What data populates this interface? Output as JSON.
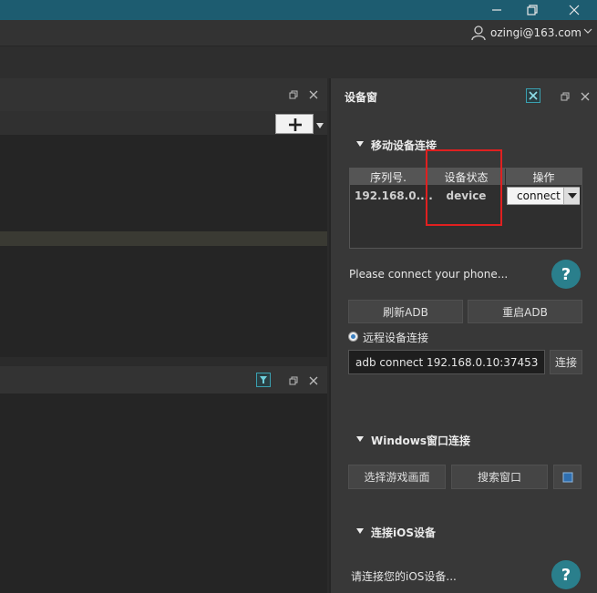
{
  "window": {
    "minimize_icon": "minimize-icon",
    "restore_icon": "restore-icon",
    "close_icon": "close-icon"
  },
  "account": {
    "user": "ozingi@163.com"
  },
  "device_panel": {
    "title": "设备窗",
    "mobile_section": {
      "title": "移动设备连接",
      "table": {
        "headers": [
          "序列号.",
          "设备状态",
          "操作"
        ],
        "rows": [
          {
            "serial": "192.168.0....",
            "status": "device",
            "action": "connect"
          }
        ]
      },
      "hint": "Please connect your phone...",
      "refresh_adb": "刷新ADB",
      "restart_adb": "重启ADB"
    },
    "remote_section": {
      "title": "远程设备连接",
      "input_value": "adb connect 192.168.0.10:37453",
      "connect_label": "连接"
    },
    "windows_section": {
      "title": "Windows窗口连接",
      "select_game": "选择游戏画面",
      "search_window": "搜索窗口"
    },
    "ios_section": {
      "title": "连接iOS设备",
      "hint": "请连接您的iOS设备..."
    },
    "help_label": "?"
  },
  "colors": {
    "titlebar": "#1d5c70",
    "accent": "#2a7f8c",
    "highlight_box": "#e02020"
  }
}
